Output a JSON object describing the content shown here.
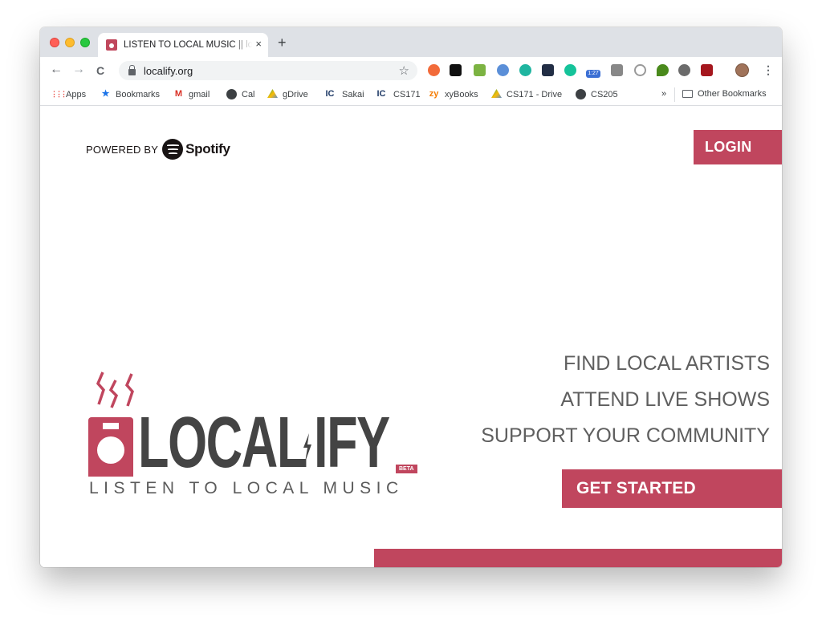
{
  "browser": {
    "tab": {
      "title": "LISTEN TO LOCAL MUSIC || localify",
      "close": "×"
    },
    "new_tab": "+",
    "nav": {
      "back": "←",
      "forward": "→",
      "reload": "C"
    },
    "url": "localify.org",
    "star": "☆",
    "extensions_badge": "1:27",
    "menu": "⋮",
    "bookmarks": [
      {
        "label": "Apps",
        "icon": "apps-grid-icon"
      },
      {
        "label": "Bookmarks",
        "icon": "star-icon"
      },
      {
        "label": "gmail",
        "icon": "gmail-icon"
      },
      {
        "label": "Cal",
        "icon": "globe-icon"
      },
      {
        "label": "gDrive",
        "icon": "drive-icon"
      },
      {
        "label": "Sakai",
        "icon": "ic-icon"
      },
      {
        "label": "CS171",
        "icon": "ic-icon"
      },
      {
        "label": "xyBooks",
        "icon": "zy-icon"
      },
      {
        "label": "CS171 - Drive",
        "icon": "drive-icon"
      },
      {
        "label": "CS205",
        "icon": "globe-icon"
      }
    ],
    "bookmarks_overflow": "»",
    "other_bookmarks": "Other Bookmarks"
  },
  "page": {
    "powered_by": "POWERED BY",
    "spotify": "Spotify",
    "login": "LOGIN",
    "logo": {
      "local": "LOCAL",
      "ify": "IFY",
      "beta": "BETA",
      "tagline": "LISTEN TO LOCAL MUSIC"
    },
    "features": [
      "FIND LOCAL ARTISTS",
      "ATTEND LIVE SHOWS",
      "SUPPORT YOUR COMMUNITY"
    ],
    "cta": "GET STARTED",
    "colors": {
      "accent": "#c0465e",
      "text_dark": "#444444"
    }
  }
}
